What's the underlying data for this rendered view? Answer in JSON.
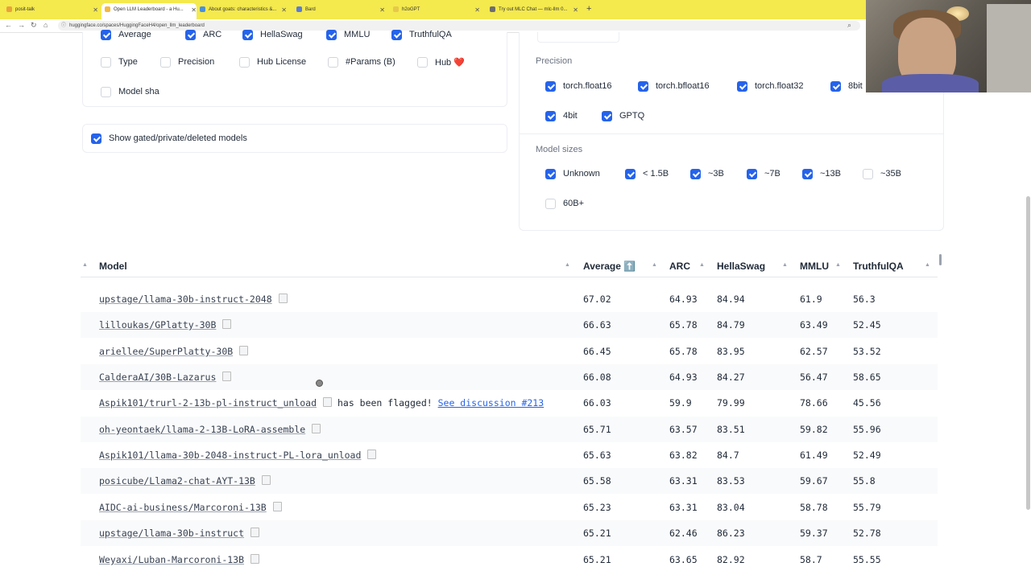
{
  "browser": {
    "tabs": [
      {
        "title": "posit-talk"
      },
      {
        "title": "Open LLM Leaderboard - a Hu..."
      },
      {
        "title": "About goats: characteristics &..."
      },
      {
        "title": "Bard"
      },
      {
        "title": "h2oGPT"
      },
      {
        "title": "Try out MLC Chat — mlc-llm 0..."
      }
    ],
    "url": "huggingface.co/spaces/HuggingFaceH4/open_llm_leaderboard"
  },
  "columns_panel": {
    "top_partial": [
      {
        "label": "Average",
        "checked": true
      },
      {
        "label": "ARC",
        "checked": true
      },
      {
        "label": "HellaSwag",
        "checked": true
      },
      {
        "label": "MMLU",
        "checked": true
      },
      {
        "label": "TruthfulQA",
        "checked": true
      }
    ],
    "options": [
      {
        "label": "Type",
        "checked": false
      },
      {
        "label": "Precision",
        "checked": false
      },
      {
        "label": "Hub License",
        "checked": false
      },
      {
        "label": "#Params (B)",
        "checked": false
      },
      {
        "label": "Hub ❤️",
        "checked": false
      },
      {
        "label": "Model sha",
        "checked": false
      }
    ],
    "show_gated": {
      "label": "Show gated/private/deleted models",
      "checked": true
    }
  },
  "precision": {
    "label": "Precision",
    "options": [
      {
        "label": "torch.float16",
        "checked": true
      },
      {
        "label": "torch.bfloat16",
        "checked": true
      },
      {
        "label": "torch.float32",
        "checked": true
      },
      {
        "label": "8bit",
        "checked": true
      },
      {
        "label": "4bit",
        "checked": true
      },
      {
        "label": "GPTQ",
        "checked": true
      }
    ]
  },
  "model_sizes": {
    "label": "Model sizes",
    "options": [
      {
        "label": "Unknown",
        "checked": true
      },
      {
        "label": "< 1.5B",
        "checked": true
      },
      {
        "label": "~3B",
        "checked": true
      },
      {
        "label": "~7B",
        "checked": true
      },
      {
        "label": "~13B",
        "checked": true
      },
      {
        "label": "~35B",
        "checked": false
      },
      {
        "label": "60B+",
        "checked": false
      }
    ]
  },
  "table": {
    "headers": {
      "model": "Model",
      "average": "Average ⬆️",
      "arc": "ARC",
      "hellaswag": "HellaSwag",
      "mmlu": "MMLU",
      "truthfulqa": "TruthfulQA"
    },
    "rows": [
      {
        "model": "upstage/llama-30b-instruct-2048",
        "average": "67.02",
        "arc": "64.93",
        "hellaswag": "84.94",
        "mmlu": "61.9",
        "truthfulqa": "56.3"
      },
      {
        "model": "lilloukas/GPlatty-30B",
        "average": "66.63",
        "arc": "65.78",
        "hellaswag": "84.79",
        "mmlu": "63.49",
        "truthfulqa": "52.45"
      },
      {
        "model": "ariellee/SuperPlatty-30B",
        "average": "66.45",
        "arc": "65.78",
        "hellaswag": "83.95",
        "mmlu": "62.57",
        "truthfulqa": "53.52"
      },
      {
        "model": "CalderaAI/30B-Lazarus",
        "average": "66.08",
        "arc": "64.93",
        "hellaswag": "84.27",
        "mmlu": "56.47",
        "truthfulqa": "58.65"
      },
      {
        "model": "Aspik101/trurl-2-13b-pl-instruct_unload",
        "flag": "has been flagged!",
        "discussion": "See discussion #213",
        "average": "66.03",
        "arc": "59.9",
        "hellaswag": "79.99",
        "mmlu": "78.66",
        "truthfulqa": "45.56"
      },
      {
        "model": "oh-yeontaek/llama-2-13B-LoRA-assemble",
        "average": "65.71",
        "arc": "63.57",
        "hellaswag": "83.51",
        "mmlu": "59.82",
        "truthfulqa": "55.96"
      },
      {
        "model": "Aspik101/llama-30b-2048-instruct-PL-lora_unload",
        "average": "65.63",
        "arc": "63.82",
        "hellaswag": "84.7",
        "mmlu": "61.49",
        "truthfulqa": "52.49"
      },
      {
        "model": "posicube/Llama2-chat-AYT-13B",
        "average": "65.58",
        "arc": "63.31",
        "hellaswag": "83.53",
        "mmlu": "59.67",
        "truthfulqa": "55.8"
      },
      {
        "model": "AIDC-ai-business/Marcoroni-13B",
        "average": "65.23",
        "arc": "63.31",
        "hellaswag": "83.04",
        "mmlu": "58.78",
        "truthfulqa": "55.79"
      },
      {
        "model": "upstage/llama-30b-instruct",
        "average": "65.21",
        "arc": "62.46",
        "hellaswag": "86.23",
        "mmlu": "59.37",
        "truthfulqa": "52.78"
      },
      {
        "model": "Weyaxi/Luban-Marcoroni-13B",
        "average": "65.21",
        "arc": "63.65",
        "hellaswag": "82.92",
        "mmlu": "58.7",
        "truthfulqa": "55.55"
      }
    ]
  }
}
